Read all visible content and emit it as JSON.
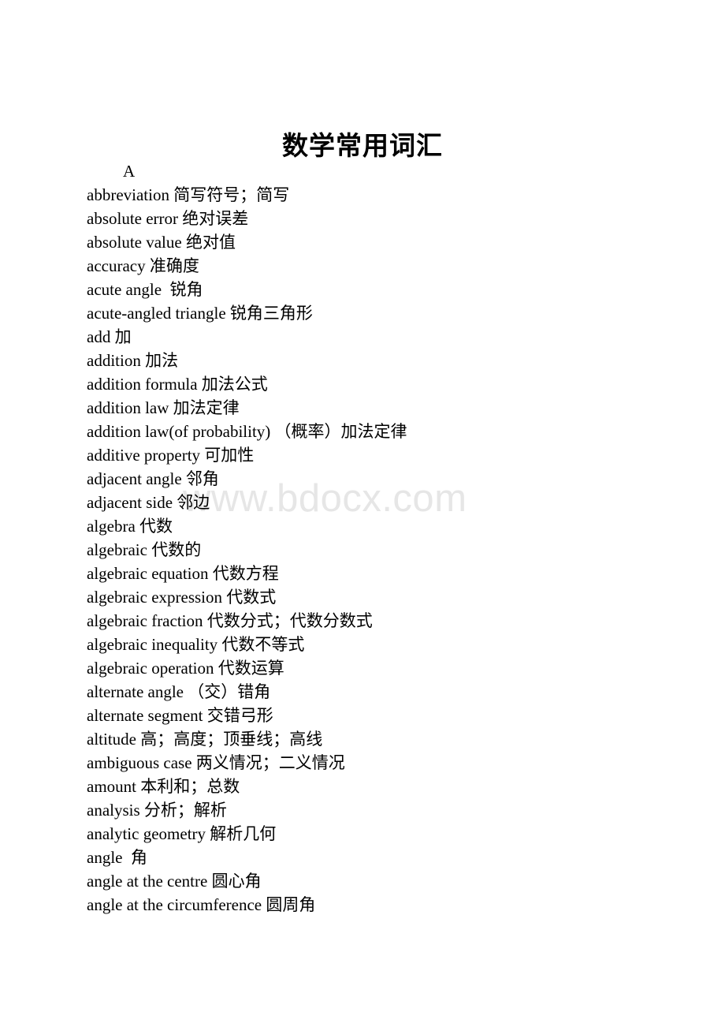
{
  "document": {
    "title": "数学常用词汇",
    "watermark": "www.bdocx.com",
    "page_background": "#ffffff",
    "text_color": "#000000",
    "watermark_color": "#e6e6e6"
  },
  "sections": [
    {
      "letter": "A",
      "entries": [
        "abbreviation 简写符号；简写",
        "absolute error 绝对误差",
        "absolute value 绝对值",
        "accuracy 准确度",
        "acute angle  锐角",
        "acute-angled triangle 锐角三角形",
        "add 加",
        "addition 加法",
        "addition formula 加法公式",
        "addition law 加法定律",
        "addition law(of probability) （概率）加法定律",
        "additive property 可加性",
        "adjacent angle 邻角",
        "adjacent side 邻边",
        "algebra 代数",
        "algebraic 代数的",
        "algebraic equation 代数方程",
        "algebraic expression 代数式",
        "algebraic fraction 代数分式；代数分数式",
        "algebraic inequality 代数不等式",
        "algebraic operation 代数运算",
        "alternate angle （交）错角",
        "alternate segment 交错弓形",
        "altitude 高；高度；顶垂线；高线",
        "ambiguous case 两义情况；二义情况",
        "amount 本利和；总数",
        "analysis 分析；解析",
        "analytic geometry 解析几何",
        "angle  角",
        "angle at the centre 圆心角",
        "angle at the circumference 圆周角"
      ]
    }
  ]
}
